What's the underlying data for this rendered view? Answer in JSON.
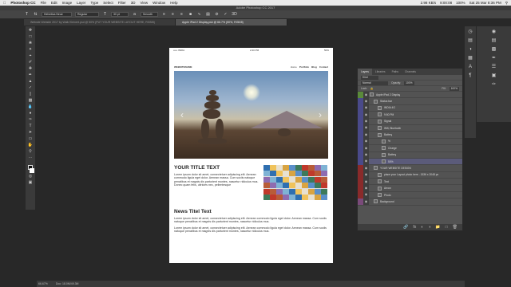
{
  "menubar": {
    "app_name": "Photoshop CC",
    "menus": [
      "File",
      "Edit",
      "Image",
      "Layer",
      "Type",
      "Select",
      "Filter",
      "3D",
      "View",
      "Window",
      "Help"
    ],
    "battery": "100%",
    "clock": "Sat 25 Mar 8:36 PM",
    "status_items": [
      "2.98 KB/s",
      "8:00:08"
    ]
  },
  "window_title": "Adobe Photoshop CC 2017",
  "options_bar": {
    "font_family": "Helvetica Neue",
    "font_style": "Regular",
    "font_size": "30 pt",
    "antialias": "Smooth"
  },
  "tabs": [
    {
      "label": "Website Website 2017 by Walk Kleinert.psd @ 50% (PUT YOUR WEBSITE LAYOUT HERE, RGB/8)",
      "active": false
    },
    {
      "label": "Apple iPad 2 Display.psb @ 66.7% (50%, RGB/8)",
      "active": true
    }
  ],
  "artboard": {
    "status_left": "••••• INDIA",
    "status_time": "2:20 PM",
    "status_right": "50%",
    "logo": "WEBSITENAME",
    "nav_links": [
      "Home",
      "Portfolio",
      "Blog",
      "Contact"
    ],
    "nav_active": "Portfolio",
    "hero_prev": "‹",
    "hero_next": "›",
    "section_title": "YOUR TITLE TEXT",
    "section_body": "Lorem ipsum dolor sit amet, consectetuer adipiscing elit. Aenean commodo ligula eget dolor. Aenean massa. Cum sociis natoque penatibus et magnis dis parturient montes, nascetur ridiculus mus. Donec quam felis, ultricies nec, pellentesque",
    "news_title": "News Titel Text",
    "news_body_1": "Lorem ipsum dolor sit amet, consectetuer adipiscing elit. Aenean commodo ligula eget dolor. Aenean massa. Cum sociis natoque penatibus et magnis dis parturient montes, nascetur ridiculus mus.",
    "news_body_2": "Lorem ipsum dolor sit amet, consectetuer adipiscing elit. Aenean commodo ligula eget dolor. Aenean massa. Cum sociis natoque penatibus et magnis dis parturient montes, nascetur ridiculus mus."
  },
  "layers_panel": {
    "tabs": [
      "Layers",
      "Libraries",
      "Paths",
      "Channels"
    ],
    "kind_filter": "Kind",
    "blend_mode": "Normal",
    "opacity_label": "Opacity:",
    "opacity": "100%",
    "lock_label": "Lock:",
    "fill_label": "Fill:",
    "fill": "100%",
    "layers": [
      {
        "name": "Apple iPad 2 Display",
        "indent": 0,
        "color": "#5a8a3a"
      },
      {
        "name": "Status bar",
        "indent": 1,
        "color": "#4a4a8a"
      },
      {
        "name": "INDIA    4G",
        "indent": 2,
        "color": "#4a4a8a"
      },
      {
        "name": "9:50 PM",
        "indent": 2,
        "color": "#4a4a8a"
      },
      {
        "name": "Signal",
        "indent": 2,
        "color": "#4a4a8a"
      },
      {
        "name": "Wifi, Bluetooth",
        "indent": 2,
        "color": "#4a4a8a"
      },
      {
        "name": "Battery",
        "indent": 2,
        "color": "#4a4a8a"
      },
      {
        "name": "%",
        "indent": 3,
        "color": "#4a4a8a"
      },
      {
        "name": "Charge",
        "indent": 3,
        "color": "#4a4a8a"
      },
      {
        "name": "Battery",
        "indent": 3,
        "color": "#4a4a8a"
      },
      {
        "name": "50%",
        "indent": 3,
        "color": "#4a4a8a",
        "selected": true
      },
      {
        "name": "YOUR WEBSITE DESIGN",
        "indent": 1,
        "color": "#8a2a2a"
      },
      {
        "name": "place your Layout photo here - 1536 x 2048 px",
        "indent": 2,
        "color": "#8a2a2a"
      },
      {
        "name": "Text",
        "indent": 2,
        "color": "#8a2a2a"
      },
      {
        "name": "Arrow",
        "indent": 2,
        "color": "#8a2a2a"
      },
      {
        "name": "Photo",
        "indent": 2,
        "color": "#8a2a2a"
      },
      {
        "name": "Background",
        "indent": 1,
        "color": "#7a4a7a"
      }
    ]
  },
  "statusbar": {
    "zoom": "66.67%",
    "doc": "Doc: 18.0M/49.3M"
  }
}
